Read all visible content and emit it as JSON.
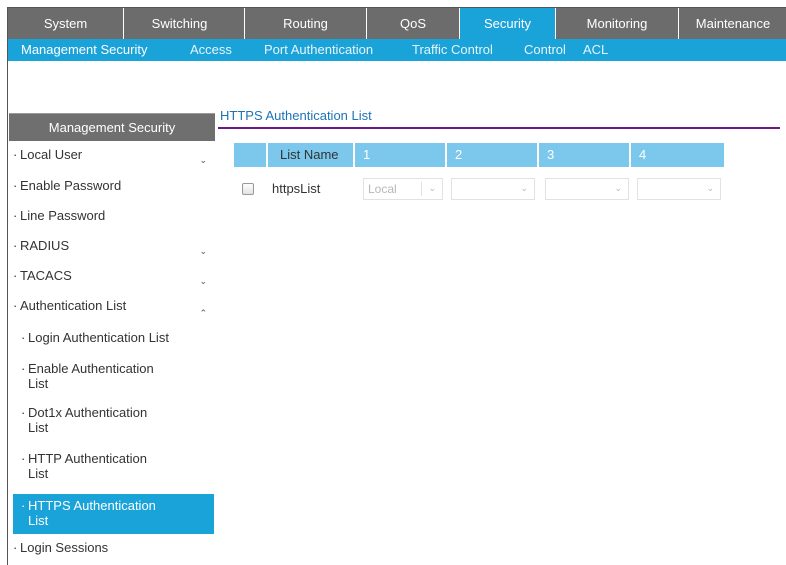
{
  "topnav": {
    "tabs": [
      {
        "label": "System"
      },
      {
        "label": "Switching"
      },
      {
        "label": "Routing"
      },
      {
        "label": "QoS"
      },
      {
        "label": "Security",
        "active": true
      },
      {
        "label": "Monitoring"
      },
      {
        "label": "Maintenance"
      }
    ]
  },
  "subnav": {
    "items": [
      {
        "label": "Management Security",
        "active": true
      },
      {
        "label": "Access"
      },
      {
        "label": "Port Authentication"
      },
      {
        "label": "Traffic Control"
      },
      {
        "label": "Control"
      },
      {
        "label": "ACL"
      }
    ]
  },
  "sidebar": {
    "title": "Management Security",
    "items": [
      {
        "label": "Local User",
        "chevron": "down"
      },
      {
        "label": "Enable Password"
      },
      {
        "label": "Line Password"
      },
      {
        "label": "RADIUS",
        "chevron": "down"
      },
      {
        "label": "TACACS",
        "chevron": "down"
      },
      {
        "label": "Authentication List",
        "chevron": "up"
      },
      {
        "label": "Login Authentication List"
      },
      {
        "label": "Enable Authentication",
        "label2": "List"
      },
      {
        "label": "Dot1x Authentication",
        "label2": "List"
      },
      {
        "label": "HTTP Authentication",
        "label2": "List"
      },
      {
        "label": "HTTPS Authentication",
        "label2": "List",
        "active": true
      },
      {
        "label": "Login Sessions"
      }
    ]
  },
  "content": {
    "title": "HTTPS Authentication List",
    "table": {
      "headers": [
        "List Name",
        "1",
        "2",
        "3",
        "4"
      ],
      "rows": [
        {
          "name": "httpsList",
          "methods": [
            "Local",
            "",
            "",
            ""
          ]
        }
      ]
    }
  },
  "colors": {
    "nav_gray": "#6c6c6c",
    "accent_blue": "#1aa3d9",
    "header_blue": "#7bc8ec",
    "title_blue": "#1d73b6",
    "rule_purple": "#6a1a8a"
  }
}
